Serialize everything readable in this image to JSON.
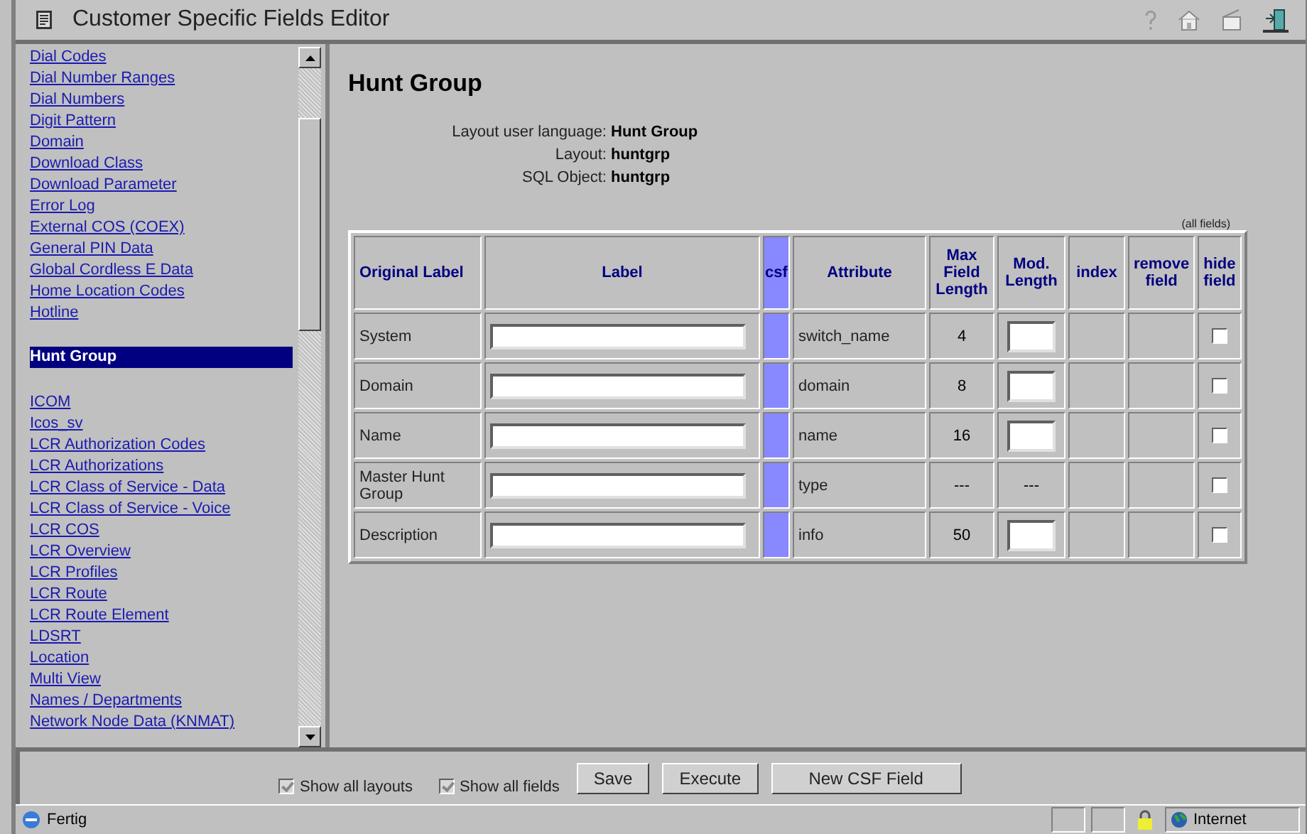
{
  "window": {
    "title": "Customer Specific Fields Editor"
  },
  "sidebar": {
    "items": [
      {
        "label": "Dial Codes",
        "selected": false
      },
      {
        "label": "Dial Number Ranges",
        "selected": false
      },
      {
        "label": "Dial Numbers",
        "selected": false
      },
      {
        "label": "Digit Pattern",
        "selected": false
      },
      {
        "label": "Domain",
        "selected": false
      },
      {
        "label": "Download Class",
        "selected": false
      },
      {
        "label": "Download Parameter",
        "selected": false
      },
      {
        "label": "Error Log",
        "selected": false
      },
      {
        "label": "External COS (COEX)",
        "selected": false
      },
      {
        "label": "General PIN Data",
        "selected": false
      },
      {
        "label": "Global Cordless E Data",
        "selected": false
      },
      {
        "label": "Home Location Codes",
        "selected": false
      },
      {
        "label": "Hotline",
        "selected": false
      },
      {
        "label": "Hunt Group",
        "selected": true
      },
      {
        "label": "ICOM",
        "selected": false
      },
      {
        "label": "Icos_sv",
        "selected": false
      },
      {
        "label": "LCR Authorization Codes",
        "selected": false
      },
      {
        "label": "LCR Authorizations",
        "selected": false
      },
      {
        "label": "LCR Class of Service - Data",
        "selected": false
      },
      {
        "label": "LCR Class of Service - Voice",
        "selected": false
      },
      {
        "label": "LCR COS",
        "selected": false
      },
      {
        "label": "LCR Overview",
        "selected": false
      },
      {
        "label": "LCR Profiles",
        "selected": false
      },
      {
        "label": "LCR Route",
        "selected": false
      },
      {
        "label": "LCR Route Element",
        "selected": false
      },
      {
        "label": "LDSRT",
        "selected": false
      },
      {
        "label": "Location",
        "selected": false
      },
      {
        "label": "Multi View",
        "selected": false
      },
      {
        "label": "Names / Departments",
        "selected": false
      },
      {
        "label": "Network Node Data (KNMAT)",
        "selected": false
      }
    ]
  },
  "main": {
    "heading": "Hunt Group",
    "info": [
      {
        "label": "Layout user language:",
        "value": "Hunt Group"
      },
      {
        "label": "Layout:",
        "value": "huntgrp"
      },
      {
        "label": "SQL Object:",
        "value": "huntgrp"
      }
    ],
    "all_fields_link": "(all fields)",
    "table": {
      "columns": [
        "Original Label",
        "Label",
        "csf",
        "Attribute",
        "Max Field Length",
        "Mod. Length",
        "index",
        "remove field",
        "hide field"
      ],
      "rows": [
        {
          "original_label": "System",
          "attribute": "switch_name",
          "max_length": "4",
          "kind": "field",
          "hide": false
        },
        {
          "original_label": "Domain",
          "attribute": "domain",
          "max_length": "8",
          "kind": "field",
          "hide": false
        },
        {
          "original_label": "Name",
          "attribute": "name",
          "max_length": "16",
          "kind": "field",
          "hide": false
        },
        {
          "original_label": "Master Hunt Group",
          "attribute": "type",
          "max_length": "---",
          "kind": "text",
          "mod_length": "---",
          "hide": false
        },
        {
          "original_label": "Description",
          "attribute": "info",
          "max_length": "50",
          "kind": "field",
          "hide": false
        }
      ]
    }
  },
  "bottom_bar": {
    "options": [
      {
        "label": "Show all layouts",
        "checked": true
      },
      {
        "label": "Show all fields",
        "checked": true
      }
    ],
    "buttons": [
      "Save",
      "Execute",
      "New CSF Field"
    ]
  },
  "status_bar": {
    "text": "Fertig",
    "zone": "Internet"
  }
}
